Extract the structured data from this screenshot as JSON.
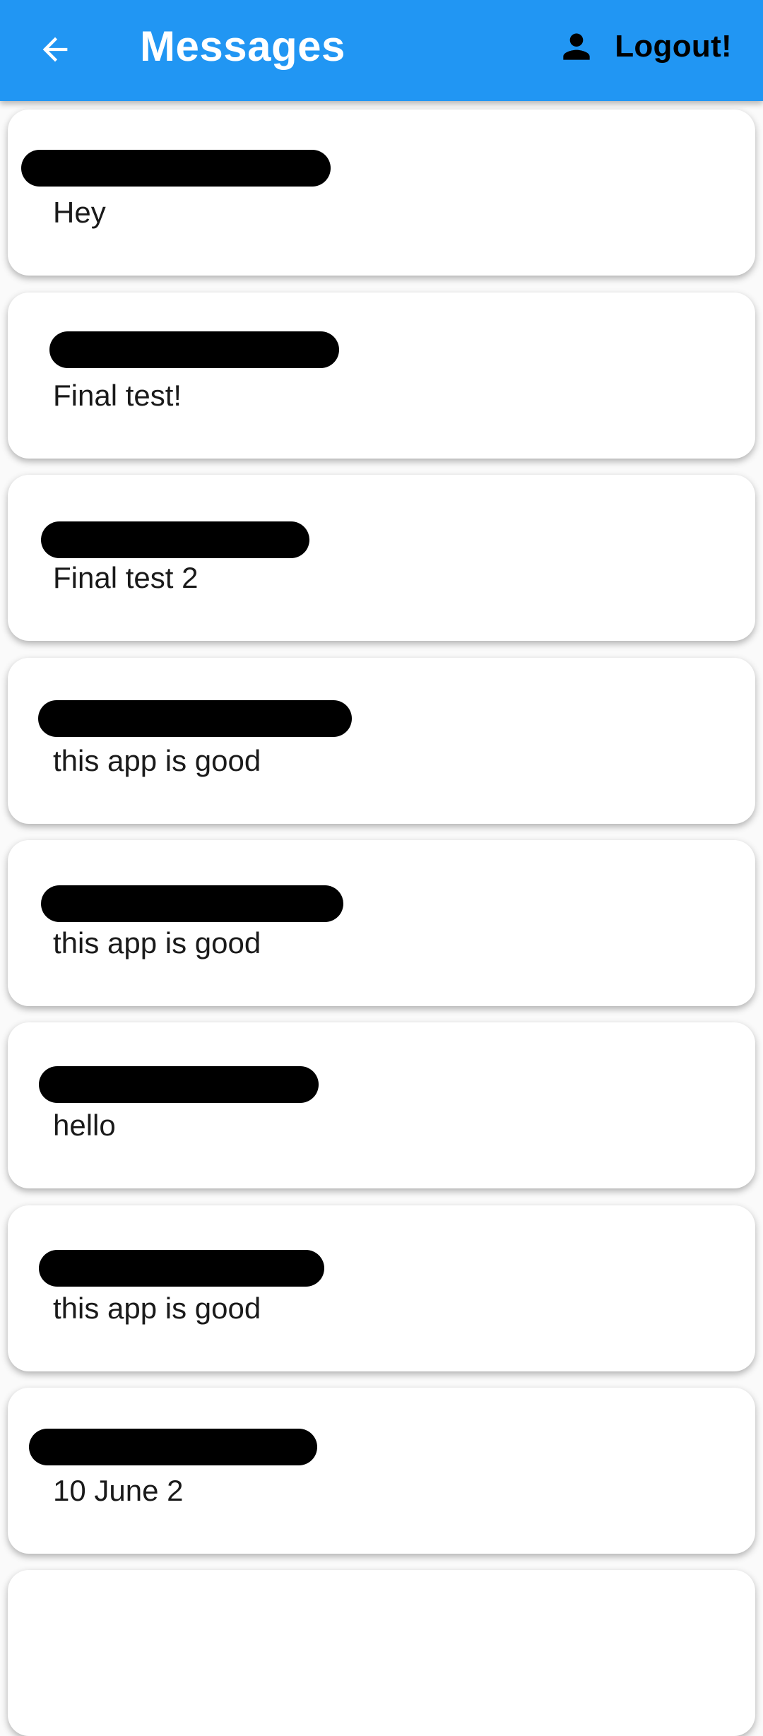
{
  "app": {
    "title": "Messages",
    "accent_color": "#2196f3"
  },
  "appbar": {
    "back_icon": "arrow-back-icon",
    "logout_icon": "person-icon",
    "logout_label": "Logout!"
  },
  "messages": [
    {
      "sender": "",
      "text": "Hey"
    },
    {
      "sender": "",
      "text": "Final test!"
    },
    {
      "sender": "",
      "text": "Final test 2"
    },
    {
      "sender": "",
      "text": "this app is good"
    },
    {
      "sender": "",
      "text": "this app is good"
    },
    {
      "sender": "",
      "text": "hello"
    },
    {
      "sender": "",
      "text": "this app is good"
    },
    {
      "sender": "",
      "text": "10 June 2"
    }
  ]
}
